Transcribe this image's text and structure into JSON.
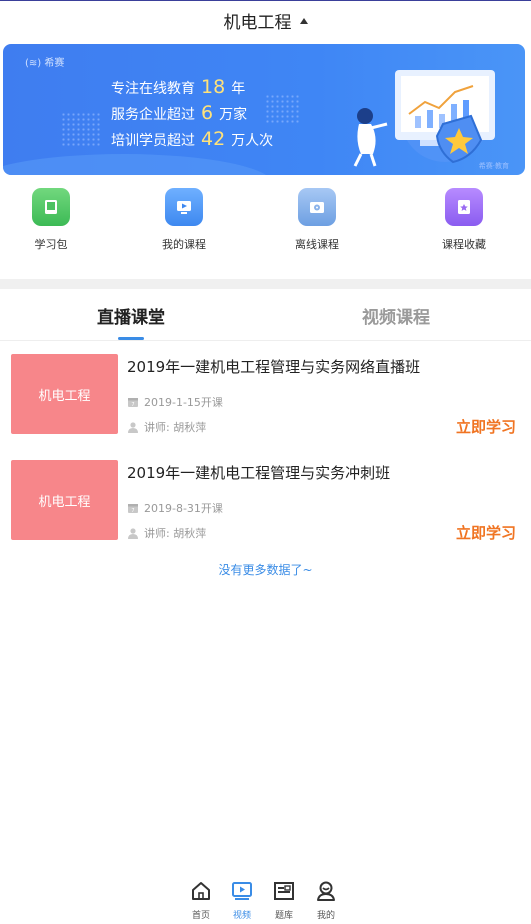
{
  "header": {
    "title": "机电工程"
  },
  "banner": {
    "brand": "希赛",
    "line1_prefix": "专注在线教育",
    "line1_num": "18",
    "line1_suffix": "年",
    "line2_prefix": "服务企业超过",
    "line2_num": "6",
    "line2_suffix": "万家",
    "line3_prefix": "培训学员超过",
    "line3_num": "42",
    "line3_suffix": "万人次",
    "footnote": "希赛·教育"
  },
  "quick_links": [
    {
      "label": "学习包",
      "icon": "book-icon"
    },
    {
      "label": "我的课程",
      "icon": "video-course-icon"
    },
    {
      "label": "离线课程",
      "icon": "offline-icon"
    },
    {
      "label": "课程收藏",
      "icon": "bookmark-icon"
    }
  ],
  "tabs": [
    {
      "label": "直播课堂",
      "active": true
    },
    {
      "label": "视频课程",
      "active": false
    }
  ],
  "courses": [
    {
      "thumb_label": "机电工程",
      "title": "2019年一建机电工程管理与实务网络直播班",
      "date": "2019-1-15开课",
      "teacher": "讲师: 胡秋萍",
      "action": "立即学习"
    },
    {
      "thumb_label": "机电工程",
      "title": "2019年一建机电工程管理与实务冲刺班",
      "date": "2019-8-31开课",
      "teacher": "讲师: 胡秋萍",
      "action": "立即学习"
    }
  ],
  "list_footer": "没有更多数据了~",
  "bottom_nav": [
    {
      "label": "首页",
      "icon": "home-icon",
      "active": false
    },
    {
      "label": "视频",
      "icon": "video-icon",
      "active": true
    },
    {
      "label": "题库",
      "icon": "question-bank-icon",
      "active": false
    },
    {
      "label": "我的",
      "icon": "profile-icon",
      "active": false
    }
  ],
  "colors": {
    "accent": "#3a8ce6",
    "action": "#f07422",
    "thumb": "#f7868a",
    "banner": "#3f7df0"
  }
}
